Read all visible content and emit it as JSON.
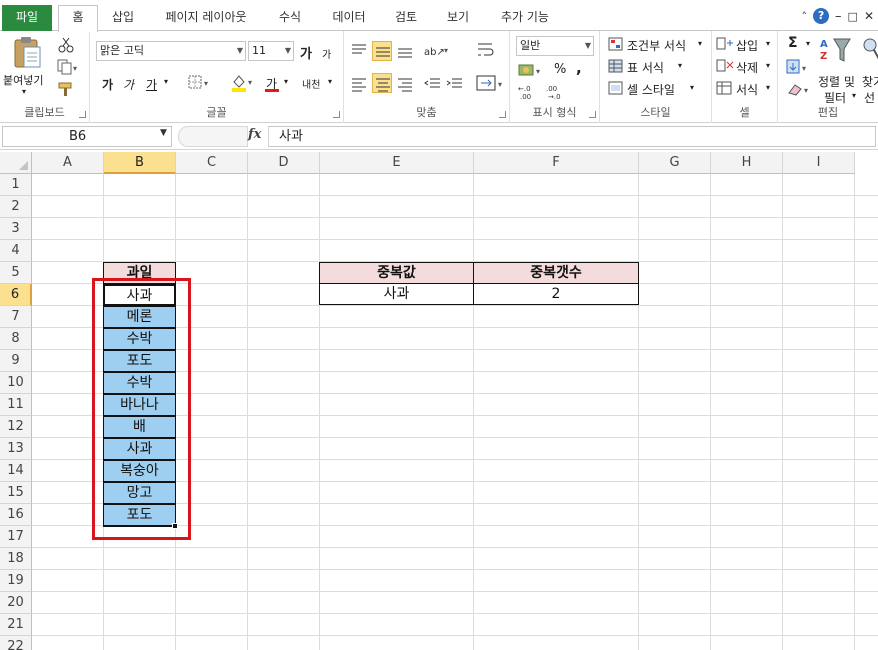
{
  "ribbon_tabs": {
    "file": "파일",
    "home": "홈",
    "insert": "삽입",
    "page_layout": "페이지 레이아웃",
    "formulas": "수식",
    "data": "데이터",
    "review": "검토",
    "view": "보기",
    "addins": "추가 기능"
  },
  "clipboard": {
    "paste": "붙여넣기",
    "label": "클립보드"
  },
  "font": {
    "name": "맑은 고딕",
    "size": "11",
    "grow": "가",
    "shrink": "가",
    "bold": "가",
    "italic": "가",
    "underline": "가",
    "font_color": "가",
    "phonetic": "내천",
    "label": "글꼴"
  },
  "alignment": {
    "label": "맞춤"
  },
  "number": {
    "format": "일반",
    "percent": "%",
    "comma": ",",
    "label": "표시 형식"
  },
  "styles": {
    "conditional": "조건부 서식",
    "table": "표 서식",
    "cell_styles": "셀 스타일",
    "label": "스타일"
  },
  "cells": {
    "insert": "삽입",
    "delete": "삭제",
    "format": "서식",
    "label": "셀"
  },
  "editing": {
    "sort_filter_1": "정렬 및",
    "sort_filter_2": "필터",
    "find_1": "찾기",
    "find_2": "선",
    "label": "편집"
  },
  "formula_bar": {
    "name_box": "B6",
    "fx": "fx",
    "content": "사과"
  },
  "columns": [
    "A",
    "B",
    "C",
    "D",
    "E",
    "F",
    "G",
    "H",
    "I"
  ],
  "active_column": "B",
  "rows": [
    "1",
    "2",
    "3",
    "4",
    "5",
    "6",
    "7",
    "8",
    "9",
    "10",
    "11",
    "12",
    "13",
    "14",
    "15",
    "16",
    "17",
    "18",
    "19",
    "20",
    "21",
    "22"
  ],
  "active_row": "6",
  "fruit_table": {
    "header": "과일",
    "items": [
      "사과",
      "메론",
      "수박",
      "포도",
      "수박",
      "바나나",
      "배",
      "사과",
      "복숭아",
      "망고",
      "포도"
    ]
  },
  "dup_table": {
    "header_value": "중복값",
    "header_count": "중복갯수",
    "value": "사과",
    "count": "2"
  },
  "colors": {
    "fruit_fill": "#9fcff0",
    "header_fill": "#f4dcdc",
    "highlight_border": "#d8141c",
    "file_tab": "#2a8b3f",
    "active_header": "#fbe08f"
  }
}
